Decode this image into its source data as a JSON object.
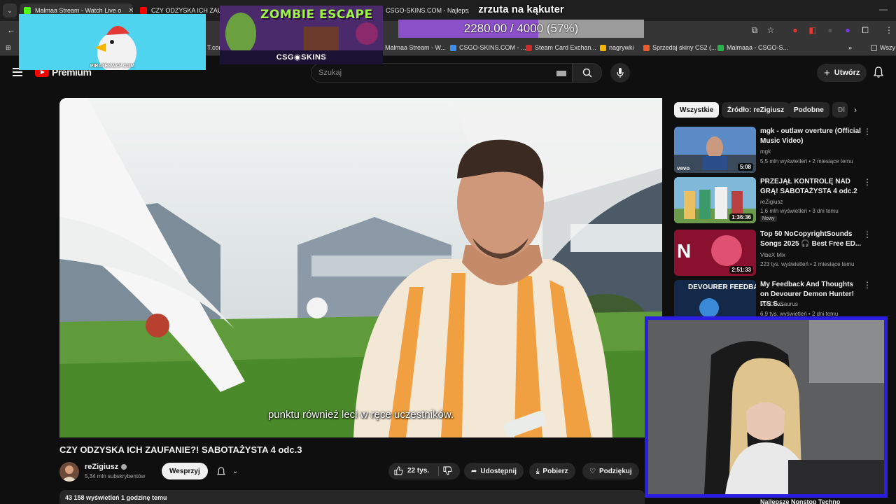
{
  "browser": {
    "tabs": [
      {
        "title": "Malmaa Stream - Watch Live o",
        "color": "#53fc18"
      },
      {
        "title": "CZY ODZYSKA ICH ZAUFAN",
        "color": "#ff0000"
      },
      {
        "title": "CSGO-SKINS.COM - Najlepsze",
        "color": "#888888"
      }
    ],
    "bookmarks": [
      {
        "label": "Malmaa Stream - W...",
        "color": "#53fc18"
      },
      {
        "label": "CSGO-SKINS.COM - ...",
        "color": "#3c8fe8"
      },
      {
        "label": "Steam Card Exchan...",
        "color": "#cc2b2b"
      },
      {
        "label": "nagrywki",
        "color": "#f4b400"
      },
      {
        "label": "Sprzedaj skiny CS2 (...",
        "color": "#e85d2b"
      },
      {
        "label": "Malmaaa - CSGO-S...",
        "color": "#2bb14c"
      },
      {
        "label": "Wszy",
        "color": "#999999"
      }
    ],
    "bookmark_partial": "T.com"
  },
  "header": {
    "brand": "Premium",
    "search_placeholder": "Szukaj",
    "create_label": "Utwórz"
  },
  "video": {
    "subtitle": "punktu również leci w ręce uczestników.",
    "title": "CZY ODZYSKA ICH ZAUFANIE?! SABOTAŻYSTA 4 odc.3",
    "channel": "reZigiusz",
    "subscribers": "5,34 mln subskrybentów",
    "support_label": "Wesprzyj",
    "likes": "22 tys.",
    "share_label": "Udostępnij",
    "download_label": "Pobierz",
    "thanks_label": "Podziękuj",
    "views_line": "43 158 wyświetleń  1 godzinę temu"
  },
  "sidebar": {
    "chips": [
      "Wszystkie",
      "Źródło: reZigiusz",
      "Podobne",
      "Dl"
    ],
    "recommendations": [
      {
        "title": "mgk - outlaw overture (Official Music Video)",
        "channel": "mgk",
        "meta": "5,5 mln wyświetleń • 2 miesiące temu",
        "duration": "5:08",
        "thumb": "#4a7ab0",
        "badge": ""
      },
      {
        "title": "PRZEJĄŁ KONTROLĘ NAD GRĄ! SABOTAŻYSTA 4 odc.2",
        "channel": "reZigiusz",
        "meta": "1,6 mln wyświetleń • 3 dni temu",
        "duration": "1:36:36",
        "thumb": "#6fa8c8",
        "badge": "Nowy"
      },
      {
        "title": "Top 50 NoCopyrightSounds Songs 2025 🎧 Best Free ED...",
        "channel": "VibeX Mix",
        "meta": "223 tys. wyświetleń • 2 miesiące temu",
        "duration": "2:51:33",
        "thumb": "#b0203a",
        "badge": ""
      },
      {
        "title": "My Feedback And Thoughts on Devourer Demon Hunter! ITS S...",
        "channel": "VooDooSaurus",
        "meta": "6,9 tys. wyświetleń • 2 dni temu",
        "duration": "",
        "thumb": "#1b3a6a",
        "badge": ""
      }
    ],
    "bottom_title": "Najlepsze Nonstop Techno"
  },
  "overlays": {
    "pirate_label": "PIRATESWAP.COM",
    "zombie_title": "ZOMBIE ESCAPE",
    "zombie_logo": "CSG◉SKINS",
    "goal_title": "zrzuta na kąkuter",
    "goal_text": "2280.00 / 4000 (57%)",
    "goal_fraction": 0.57
  }
}
